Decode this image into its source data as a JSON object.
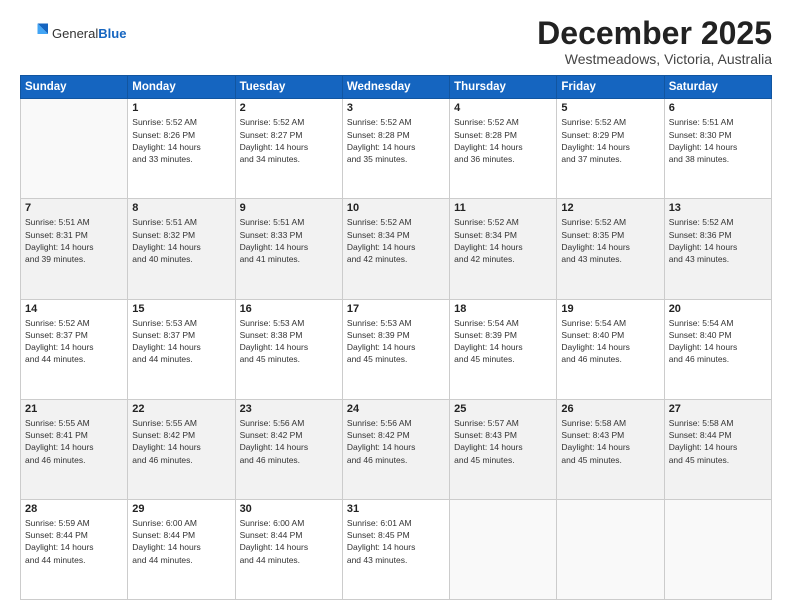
{
  "logo": {
    "general": "General",
    "blue": "Blue"
  },
  "header": {
    "month": "December 2025",
    "location": "Westmeadows, Victoria, Australia"
  },
  "weekdays": [
    "Sunday",
    "Monday",
    "Tuesday",
    "Wednesday",
    "Thursday",
    "Friday",
    "Saturday"
  ],
  "weeks": [
    [
      {
        "num": "",
        "info": ""
      },
      {
        "num": "1",
        "info": "Sunrise: 5:52 AM\nSunset: 8:26 PM\nDaylight: 14 hours\nand 33 minutes."
      },
      {
        "num": "2",
        "info": "Sunrise: 5:52 AM\nSunset: 8:27 PM\nDaylight: 14 hours\nand 34 minutes."
      },
      {
        "num": "3",
        "info": "Sunrise: 5:52 AM\nSunset: 8:28 PM\nDaylight: 14 hours\nand 35 minutes."
      },
      {
        "num": "4",
        "info": "Sunrise: 5:52 AM\nSunset: 8:28 PM\nDaylight: 14 hours\nand 36 minutes."
      },
      {
        "num": "5",
        "info": "Sunrise: 5:52 AM\nSunset: 8:29 PM\nDaylight: 14 hours\nand 37 minutes."
      },
      {
        "num": "6",
        "info": "Sunrise: 5:51 AM\nSunset: 8:30 PM\nDaylight: 14 hours\nand 38 minutes."
      }
    ],
    [
      {
        "num": "7",
        "info": "Sunrise: 5:51 AM\nSunset: 8:31 PM\nDaylight: 14 hours\nand 39 minutes."
      },
      {
        "num": "8",
        "info": "Sunrise: 5:51 AM\nSunset: 8:32 PM\nDaylight: 14 hours\nand 40 minutes."
      },
      {
        "num": "9",
        "info": "Sunrise: 5:51 AM\nSunset: 8:33 PM\nDaylight: 14 hours\nand 41 minutes."
      },
      {
        "num": "10",
        "info": "Sunrise: 5:52 AM\nSunset: 8:34 PM\nDaylight: 14 hours\nand 42 minutes."
      },
      {
        "num": "11",
        "info": "Sunrise: 5:52 AM\nSunset: 8:34 PM\nDaylight: 14 hours\nand 42 minutes."
      },
      {
        "num": "12",
        "info": "Sunrise: 5:52 AM\nSunset: 8:35 PM\nDaylight: 14 hours\nand 43 minutes."
      },
      {
        "num": "13",
        "info": "Sunrise: 5:52 AM\nSunset: 8:36 PM\nDaylight: 14 hours\nand 43 minutes."
      }
    ],
    [
      {
        "num": "14",
        "info": "Sunrise: 5:52 AM\nSunset: 8:37 PM\nDaylight: 14 hours\nand 44 minutes."
      },
      {
        "num": "15",
        "info": "Sunrise: 5:53 AM\nSunset: 8:37 PM\nDaylight: 14 hours\nand 44 minutes."
      },
      {
        "num": "16",
        "info": "Sunrise: 5:53 AM\nSunset: 8:38 PM\nDaylight: 14 hours\nand 45 minutes."
      },
      {
        "num": "17",
        "info": "Sunrise: 5:53 AM\nSunset: 8:39 PM\nDaylight: 14 hours\nand 45 minutes."
      },
      {
        "num": "18",
        "info": "Sunrise: 5:54 AM\nSunset: 8:39 PM\nDaylight: 14 hours\nand 45 minutes."
      },
      {
        "num": "19",
        "info": "Sunrise: 5:54 AM\nSunset: 8:40 PM\nDaylight: 14 hours\nand 46 minutes."
      },
      {
        "num": "20",
        "info": "Sunrise: 5:54 AM\nSunset: 8:40 PM\nDaylight: 14 hours\nand 46 minutes."
      }
    ],
    [
      {
        "num": "21",
        "info": "Sunrise: 5:55 AM\nSunset: 8:41 PM\nDaylight: 14 hours\nand 46 minutes."
      },
      {
        "num": "22",
        "info": "Sunrise: 5:55 AM\nSunset: 8:42 PM\nDaylight: 14 hours\nand 46 minutes."
      },
      {
        "num": "23",
        "info": "Sunrise: 5:56 AM\nSunset: 8:42 PM\nDaylight: 14 hours\nand 46 minutes."
      },
      {
        "num": "24",
        "info": "Sunrise: 5:56 AM\nSunset: 8:42 PM\nDaylight: 14 hours\nand 46 minutes."
      },
      {
        "num": "25",
        "info": "Sunrise: 5:57 AM\nSunset: 8:43 PM\nDaylight: 14 hours\nand 45 minutes."
      },
      {
        "num": "26",
        "info": "Sunrise: 5:58 AM\nSunset: 8:43 PM\nDaylight: 14 hours\nand 45 minutes."
      },
      {
        "num": "27",
        "info": "Sunrise: 5:58 AM\nSunset: 8:44 PM\nDaylight: 14 hours\nand 45 minutes."
      }
    ],
    [
      {
        "num": "28",
        "info": "Sunrise: 5:59 AM\nSunset: 8:44 PM\nDaylight: 14 hours\nand 44 minutes."
      },
      {
        "num": "29",
        "info": "Sunrise: 6:00 AM\nSunset: 8:44 PM\nDaylight: 14 hours\nand 44 minutes."
      },
      {
        "num": "30",
        "info": "Sunrise: 6:00 AM\nSunset: 8:44 PM\nDaylight: 14 hours\nand 44 minutes."
      },
      {
        "num": "31",
        "info": "Sunrise: 6:01 AM\nSunset: 8:45 PM\nDaylight: 14 hours\nand 43 minutes."
      },
      {
        "num": "",
        "info": ""
      },
      {
        "num": "",
        "info": ""
      },
      {
        "num": "",
        "info": ""
      }
    ]
  ]
}
